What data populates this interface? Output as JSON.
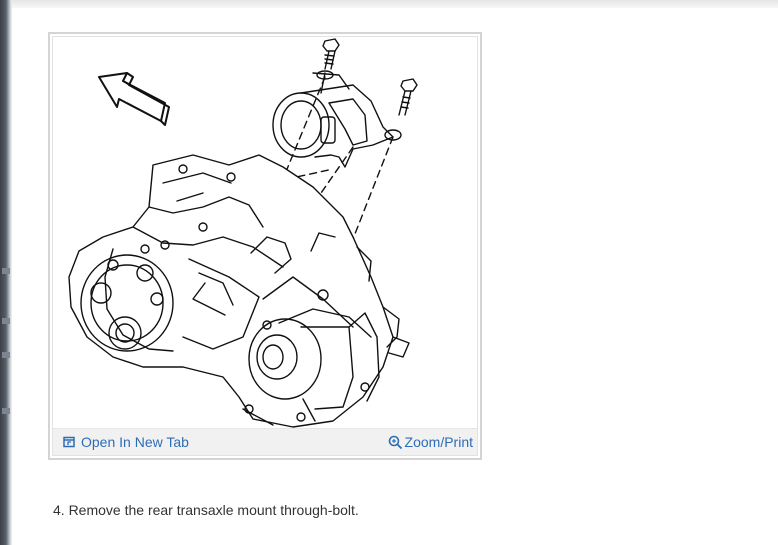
{
  "figure": {
    "open_tab_label": "Open In New Tab",
    "zoom_label": "Zoom/Print",
    "open_tab_icon": "open-new-tab-icon",
    "zoom_icon": "zoom-magnifier-icon",
    "link_color": "#2e6db5"
  },
  "step": {
    "text": "4. Remove the rear transaxle mount through-bolt."
  }
}
